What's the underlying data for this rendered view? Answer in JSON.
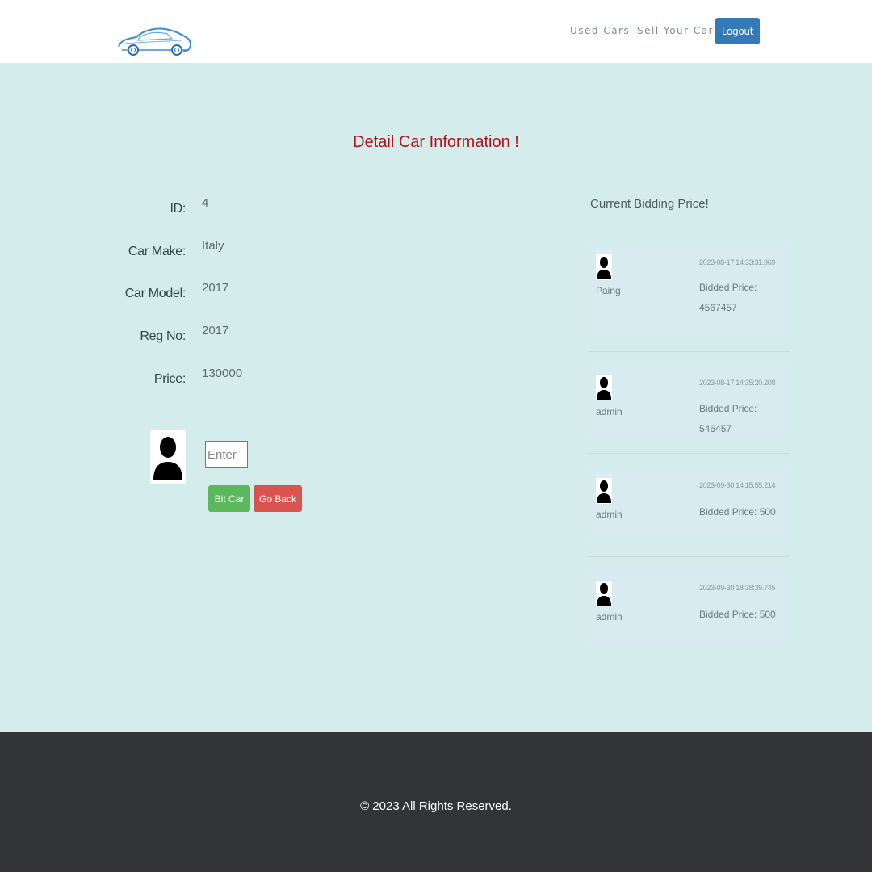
{
  "header": {
    "logo_icon": "car-logo",
    "nav": [
      {
        "label": "Used Cars"
      },
      {
        "label": "Sell Your Car"
      }
    ],
    "logout_label": "Logout",
    "accent": "#337ab7"
  },
  "title": "Detail Car Information !",
  "details": [
    {
      "label": "ID:",
      "value": "4"
    },
    {
      "label": "Car Make:",
      "value": "Italy"
    },
    {
      "label": "Car Model:",
      "value": "2017"
    },
    {
      "label": "Reg No:",
      "value": "2017"
    },
    {
      "label": "Price:",
      "value": "130000"
    }
  ],
  "bid_form": {
    "avatar_icon": "user-silhouette-icon",
    "input_placeholder": "Enter",
    "input_value": "",
    "bit_label": "Bit Car",
    "back_label": "Go Back",
    "bit_color": "#5cb85c",
    "back_color": "#d9534f"
  },
  "bidding": {
    "heading": "Current Bidding Price!",
    "bids": [
      {
        "user": "Paing",
        "time": "2023-08-17 14:33:31.969",
        "price": "Bidded Price: 4567457"
      },
      {
        "user": "admin",
        "time": "2023-08-17 14:35:20.208",
        "price": "Bidded Price: 546457"
      },
      {
        "user": "admin",
        "time": "2023-09-30 14:15:55.214",
        "price": "Bidded Price: 500"
      },
      {
        "user": "admin",
        "time": "2023-09-30 18:38:39.745",
        "price": "Bidded Price: 500"
      }
    ]
  },
  "footer": {
    "text": "© 2023 All Rights Reserved."
  }
}
